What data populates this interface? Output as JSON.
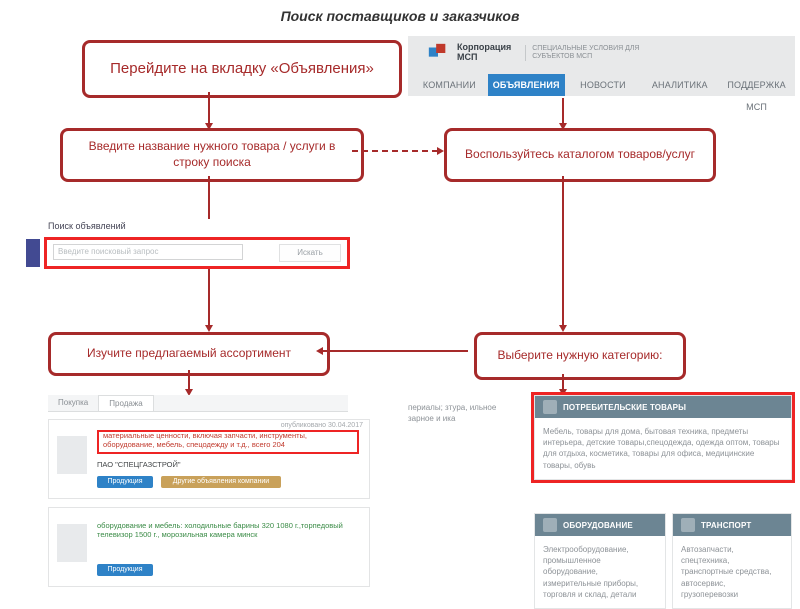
{
  "title": "Поиск поставщиков и заказчиков",
  "step1": "Перейдите на вкладку «Объявления»",
  "step2": "Введите название нужного товара / услуги в строку поиска",
  "step3": "Воспользуйтесь каталогом товаров/услуг",
  "step4": "Изучите предлагаемый ассортимент",
  "step5": "Выберите нужную категорию:",
  "nav": {
    "logo_line1": "Корпорация",
    "logo_line2": "МСП",
    "logo_sub": "СПЕЦИАЛЬНЫЕ УСЛОВИЯ ДЛЯ СУБЪЕКТОВ МСП",
    "items": [
      "КОМПАНИИ",
      "ОБЪЯВЛЕНИЯ",
      "НОВОСТИ",
      "АНАЛИТИКА",
      "ПОДДЕРЖКА МСП"
    ],
    "active_index": 1
  },
  "search": {
    "title": "Поиск объявлений",
    "placeholder": "Введите поисковый запрос",
    "button": "Искать"
  },
  "listings": {
    "tabs": [
      "Покупка",
      "Продажа"
    ],
    "item1_meta": "опубликовано 30.04.2017",
    "item1_line": "материальные ценности, включая запчасти, инструменты, оборудование, мебель, спецодежду и т.д., всего 204",
    "item1_firm": "ПАО \"СПЕЦГАЗСТРОЙ\"",
    "item1_chip1": "Продукция",
    "item1_chip2": "Другие объявления компании",
    "item2_line": "оборудование и мебель: холодильные барины 320 1080 г.,торпедовый телевизор 1500 г., морозильная камера минск"
  },
  "catalog": {
    "col1": "периалы; зтура, ильное зарное и ика",
    "main_title": "ПОТРЕБИТЕЛЬСКИЕ ТОВАРЫ",
    "main_body": "Мебель, товары для дома, бытовая техника, предметы интерьера, детские товары,спецодежда, одежда оптом, товары для отдыха, косметика, товары для офиса, медицинские товары, обувь",
    "b1_title": "ОБОРУДОВАНИЕ",
    "b1_body": "Электрооборудование, промышленное оборудование, измерительные приборы, торговля и склад, детали",
    "b2_title": "ТРАНСПОРТ",
    "b2_body": "Автозапчасти, спецтехника, транспортные средства, автосервис, грузоперевозки"
  }
}
